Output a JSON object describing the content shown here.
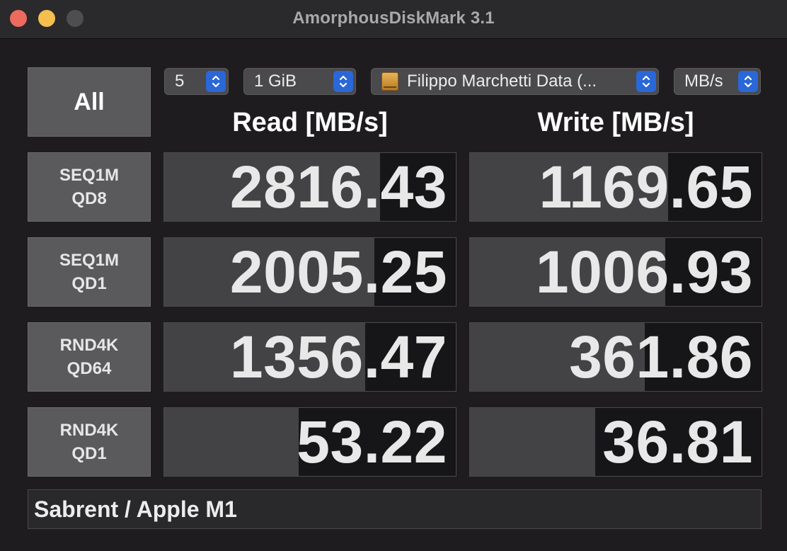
{
  "window": {
    "title": "AmorphousDiskMark 3.1"
  },
  "controls": {
    "all_label": "All",
    "count": "5",
    "size": "1 GiB",
    "target": "Filippo Marchetti Data (...",
    "unit": "MB/s"
  },
  "headers": {
    "read": "Read [MB/s]",
    "write": "Write [MB/s]"
  },
  "rows": [
    {
      "line1": "SEQ1M",
      "line2": "QD8",
      "read": "2816.43",
      "write": "1169.65",
      "read_fill": 0.74,
      "write_fill": 0.68
    },
    {
      "line1": "SEQ1M",
      "line2": "QD1",
      "read": "2005.25",
      "write": "1006.93",
      "read_fill": 0.72,
      "write_fill": 0.67
    },
    {
      "line1": "RND4K",
      "line2": "QD64",
      "read": "1356.47",
      "write": "361.86",
      "read_fill": 0.69,
      "write_fill": 0.6
    },
    {
      "line1": "RND4K",
      "line2": "QD1",
      "read": "53.22",
      "write": "36.81",
      "read_fill": 0.46,
      "write_fill": 0.43
    }
  ],
  "comment": "Sabrent / Apple M1",
  "colors": {
    "close": "#ed6a5e",
    "minimize": "#f5bf4f",
    "zoom": "#4e4d50",
    "accent": "#2a67d8",
    "bar": "#434245"
  },
  "icons": {
    "stepper": "up-down-chevron-icon",
    "drive": "external-drive-icon"
  }
}
